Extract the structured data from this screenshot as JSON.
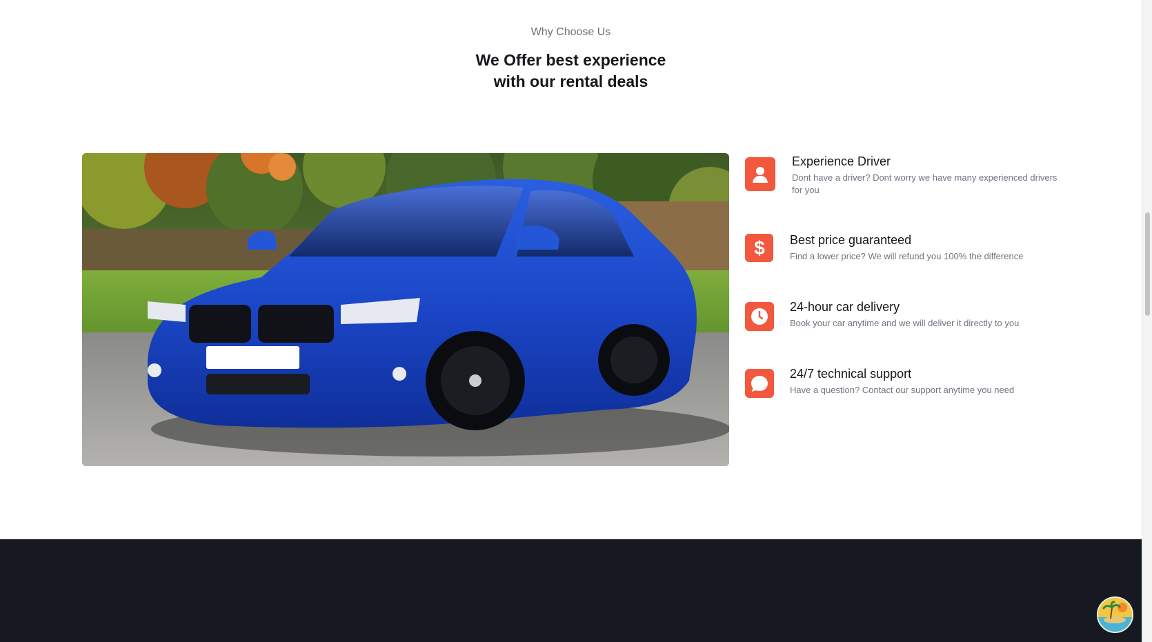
{
  "section": {
    "eyebrow": "Why Choose Us",
    "headline_line1": "We Offer best experience",
    "headline_line2": "with our rental deals"
  },
  "features": [
    {
      "icon": "driver-icon",
      "title": "Experience Driver",
      "description": "Dont have a driver? Dont worry we have many experienced drivers for you"
    },
    {
      "icon": "dollar-icon",
      "title": "Best price guaranteed",
      "description": "Find a lower price? We will refund you 100% the difference"
    },
    {
      "icon": "clock-icon",
      "title": "24-hour car delivery",
      "description": "Book your car anytime and we will deliver it directly to you"
    },
    {
      "icon": "chat-icon",
      "title": "24/7 technical support",
      "description": "Have a question? Contact our support anytime you need"
    }
  ],
  "colors": {
    "accent": "#f1583e",
    "footer_background": "#161922",
    "heading_text": "#15171c",
    "muted_text": "#6f7380"
  }
}
